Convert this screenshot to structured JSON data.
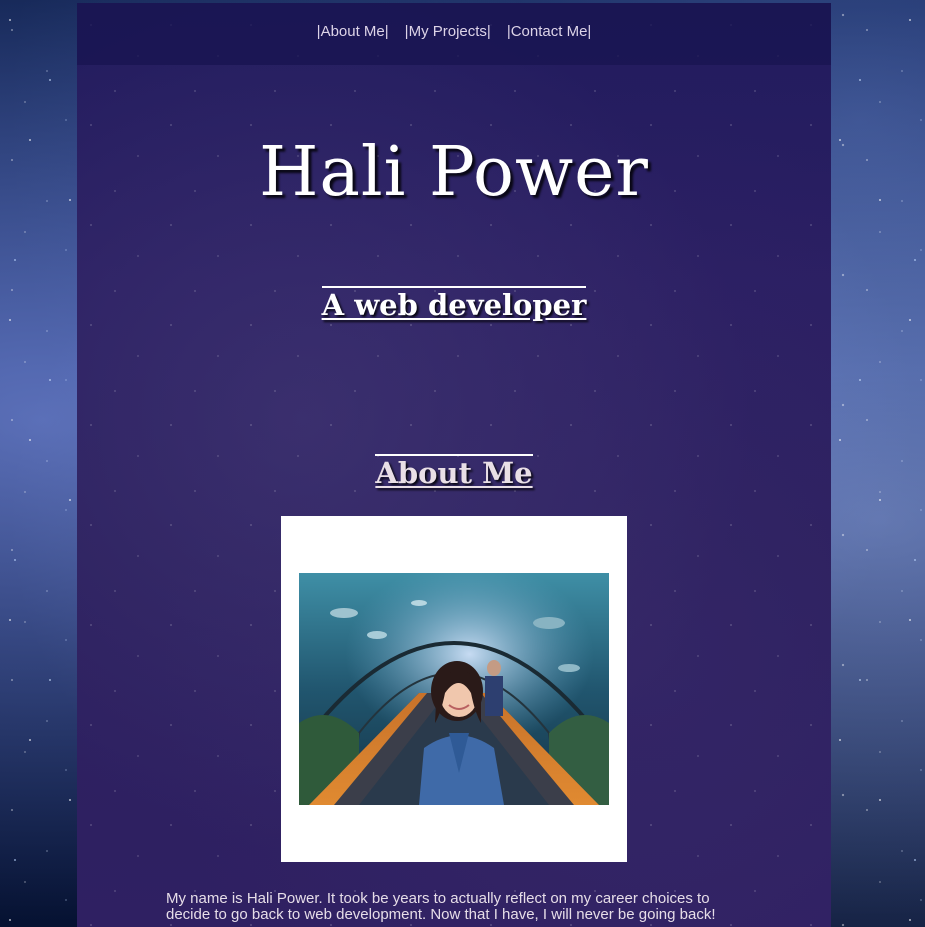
{
  "nav": {
    "items": [
      {
        "label": "|About Me|"
      },
      {
        "label": "|My Projects|"
      },
      {
        "label": "|Contact Me|"
      }
    ]
  },
  "hero": {
    "title": "Hali Power",
    "subtitle": "A web developer"
  },
  "about": {
    "heading": "About Me",
    "photo_description_icon": "profile-photo",
    "bio": "My name is Hali Power. It took be years to actually reflect on my career choices to decide to go back to web development. Now that I have, I will never be going back!"
  },
  "colors": {
    "nav_bg": "#181450",
    "panel_bg": "#2a1e62",
    "text": "#ffffff",
    "link": "#ddd4e8"
  }
}
